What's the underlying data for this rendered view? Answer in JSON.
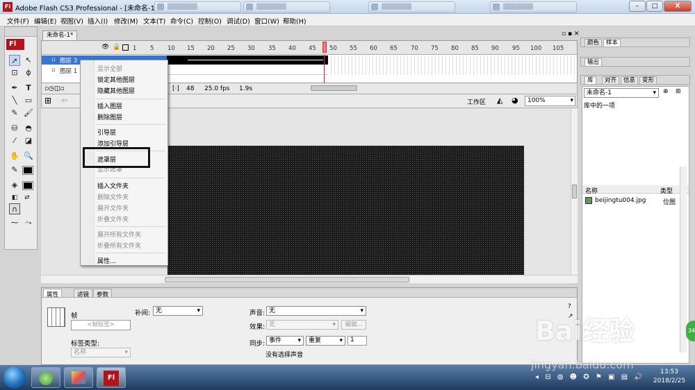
{
  "window": {
    "title": "Adobe Flash CS3 Professional - [未命名-1*]",
    "min": "–",
    "max": "□",
    "close": "X"
  },
  "menubar": [
    "文件(F)",
    "编辑(E)",
    "视图(V)",
    "插入(I)",
    "修改(M)",
    "文本(T)",
    "命令(C)",
    "控制(O)",
    "调试(D)",
    "窗口(W)",
    "帮助(H)"
  ],
  "toolbox": {
    "logo": "Fl"
  },
  "document": {
    "tab": "未命名-1*"
  },
  "timeline": {
    "frame_numbers": [
      "1",
      "5",
      "10",
      "15",
      "20",
      "25",
      "30",
      "35",
      "40",
      "45",
      "50",
      "55",
      "60",
      "65",
      "70",
      "75",
      "80",
      "85",
      "90",
      "95",
      "100",
      "105"
    ],
    "layers": [
      {
        "name": "图层 3",
        "selected": true
      },
      {
        "name": "图层 1",
        "selected": false
      }
    ],
    "current_frame": "48",
    "fps": "25.0 fps",
    "time": "1.9s"
  },
  "editbar": {
    "workspace": "工作区",
    "zoom": "100%"
  },
  "context_menu": [
    {
      "label": "显示全部",
      "enabled": false
    },
    {
      "label": "锁定其他图层",
      "enabled": true
    },
    {
      "label": "隐藏其他图层",
      "enabled": true
    },
    {
      "sep": true
    },
    {
      "label": "插入图层",
      "enabled": true
    },
    {
      "label": "删除图层",
      "enabled": true
    },
    {
      "sep": true
    },
    {
      "label": "引导层",
      "enabled": true
    },
    {
      "label": "添加引导层",
      "enabled": true
    },
    {
      "sep": true
    },
    {
      "label": "遮罩层",
      "enabled": true
    },
    {
      "label": "显示遮罩",
      "enabled": false
    },
    {
      "sep": true
    },
    {
      "label": "插入文件夹",
      "enabled": true
    },
    {
      "label": "删除文件夹",
      "enabled": false
    },
    {
      "label": "展开文件夹",
      "enabled": false
    },
    {
      "label": "折叠文件夹",
      "enabled": false
    },
    {
      "sep": true
    },
    {
      "label": "展开所有文件夹",
      "enabled": false
    },
    {
      "label": "折叠所有文件夹",
      "enabled": false
    },
    {
      "sep": true
    },
    {
      "label": "属性...",
      "enabled": true
    }
  ],
  "properties": {
    "tabs": [
      "属性",
      "滤镜",
      "参数"
    ],
    "frame_label": "帧",
    "frame_name_placeholder": "<帧标签>",
    "label_type_label": "标签类型:",
    "label_type_value": "名称",
    "tween_label": "补间:",
    "tween_value": "无",
    "sound_label": "声音:",
    "sound_value": "无",
    "effect_label": "效果:",
    "effect_value": "无",
    "edit_button": "编辑...",
    "sync_label": "同步:",
    "sync_value": "事件",
    "repeat_value": "重复",
    "repeat_count": "1",
    "no_sound": "没有选择声音"
  },
  "right_panels": {
    "tabs1": [
      "颜色",
      "样本"
    ],
    "tabs2": [
      "输出"
    ],
    "tabs3": [
      "库",
      "对齐",
      "信息",
      "变形"
    ],
    "library_doc": "未命名-1",
    "library_count": "库中的一项",
    "col_name": "名称",
    "col_type": "类型",
    "item_name": "beijingtu004.jpg",
    "item_type": "位图"
  },
  "taskbar": {
    "app_label": "Fl",
    "time": "13:53",
    "date": "2018/2/25"
  },
  "watermark": {
    "text": "Bai经验",
    "url": "jingyan.baidu.com",
    "badge": "34"
  },
  "colors": {
    "accent": "#b5131c",
    "selection": "#3874d0",
    "playhead": "#e02020"
  }
}
